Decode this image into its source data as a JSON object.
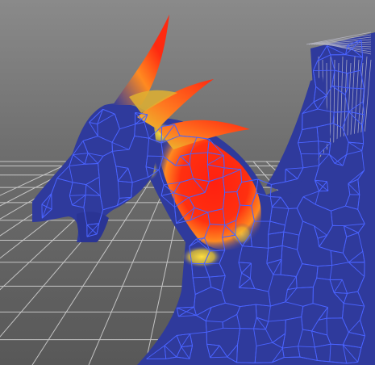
{
  "viewport": {
    "background_top": "#7a7a7a",
    "background_bottom": "#5e5e5e",
    "grid_color": "#d8d8d8",
    "mesh_fill": "#2f3a9c",
    "wire_color": "#3f5cff",
    "weight_high": "#ff2a10",
    "weight_mid": "#ff8a1a",
    "weight_low": "#e8d830",
    "bone_color": "#c8c8d8"
  }
}
